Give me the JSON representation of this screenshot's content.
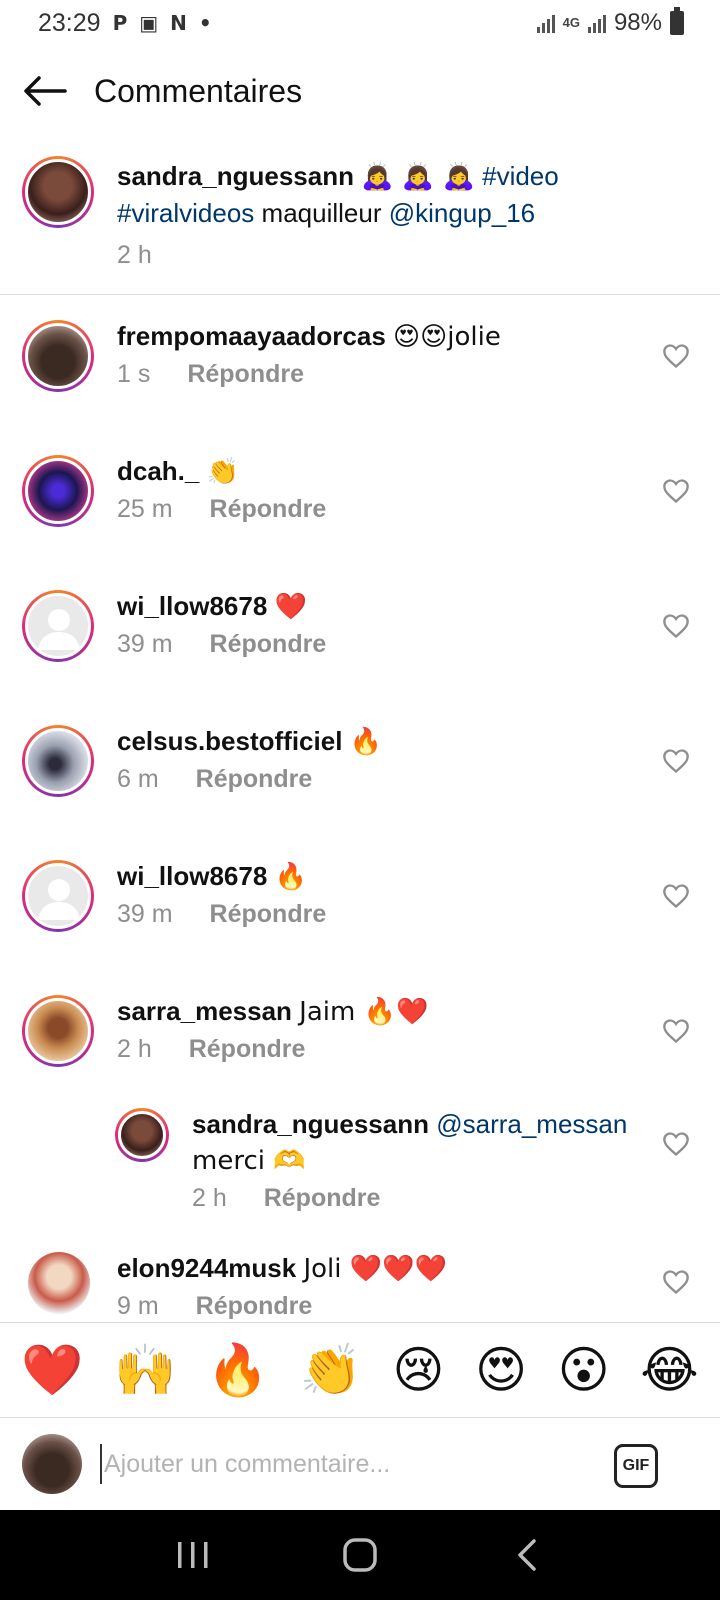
{
  "status": {
    "time": "23:29",
    "notifications": [
      "P",
      "▣",
      "N",
      "•"
    ],
    "network": "4G",
    "battery": "98%"
  },
  "header": {
    "title": "Commentaires"
  },
  "caption": {
    "username": "sandra_nguessann",
    "emojis": "🙇‍♀️ 🙇‍♀️ 🙇‍♀️",
    "hashtag1": "#video",
    "hashtag2": "#viralvideos",
    "text": "maquilleur",
    "mention": "@kingup_16",
    "time": "2 h"
  },
  "reply_label": "Répondre",
  "comments": [
    {
      "username": "frempomaayaadorcas",
      "text": "😍😍jolie",
      "time": "1 s"
    },
    {
      "username": "dcah._",
      "text": "👏",
      "time": "25 m"
    },
    {
      "username": "wi_llow8678",
      "text": "❤️",
      "time": "39 m"
    },
    {
      "username": "celsus.bestofficiel",
      "text": "🔥",
      "time": "6 m"
    },
    {
      "username": "wi_llow8678",
      "text": "🔥",
      "time": "39 m"
    },
    {
      "username": "sarra_messan",
      "text": "Jaim 🔥❤️",
      "time": "2 h"
    },
    {
      "username": "sandra_nguessann",
      "mention": "@sarra_messan",
      "text": "merci 🫶",
      "time": "2 h"
    },
    {
      "username": "elon9244musk",
      "text": "Joli ❤️❤️❤️",
      "time": "9 m"
    }
  ],
  "emoji_bar": [
    "❤️",
    "🙌",
    "🔥",
    "👏",
    "😢",
    "😍",
    "😮",
    "😂"
  ],
  "input": {
    "placeholder": "Ajouter un commentaire...",
    "gif_label": "GIF"
  },
  "colors": {
    "link": "#00376b",
    "muted": "#8e8e8e",
    "ring_start": "#f58529",
    "ring_end": "#dd2a7b"
  }
}
